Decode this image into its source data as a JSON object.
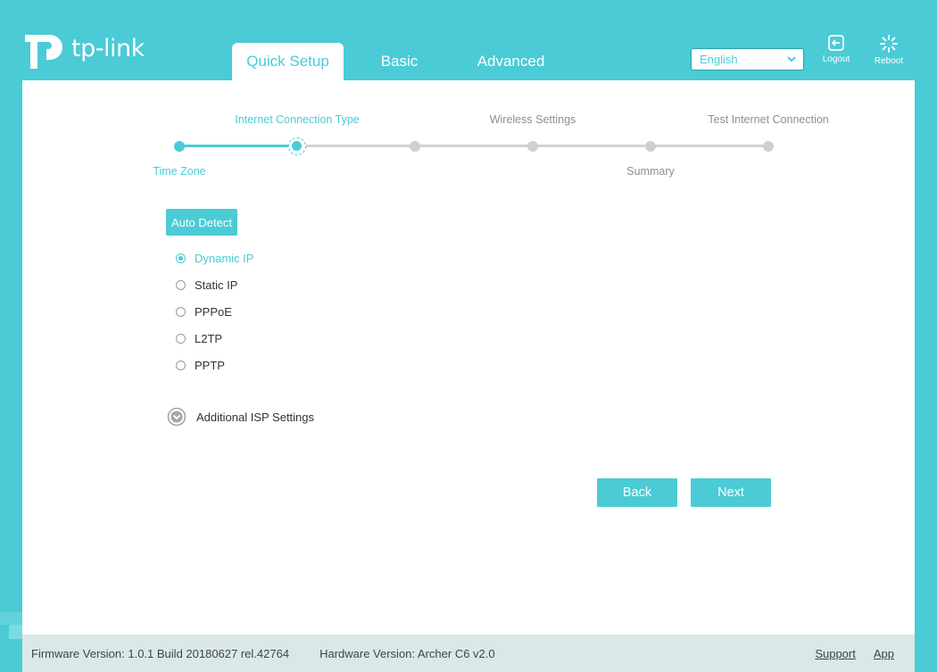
{
  "header": {
    "logo_text": "tp-link",
    "tabs": [
      {
        "label": "Quick Setup",
        "active": true
      },
      {
        "label": "Basic",
        "active": false
      },
      {
        "label": "Advanced",
        "active": false
      }
    ],
    "language": {
      "selected": "English"
    },
    "actions": [
      {
        "label": "Logout",
        "icon": "logout-icon"
      },
      {
        "label": "Reboot",
        "icon": "reboot-icon"
      }
    ]
  },
  "progress": {
    "steps": [
      {
        "label": "Time Zone",
        "state": "done"
      },
      {
        "label": "Internet Connection Type",
        "state": "current"
      },
      {
        "label": "Wireless Settings",
        "state": "todo"
      },
      {
        "label": "",
        "state": "todo"
      },
      {
        "label": "Summary",
        "state": "todo"
      },
      {
        "label": "Test Internet Connection",
        "state": "todo"
      }
    ]
  },
  "form": {
    "auto_detect_label": "Auto Detect",
    "connection_types": [
      {
        "label": "Dynamic IP",
        "checked": true
      },
      {
        "label": "Static IP",
        "checked": false
      },
      {
        "label": "PPPoE",
        "checked": false
      },
      {
        "label": "L2TP",
        "checked": false
      },
      {
        "label": "PPTP",
        "checked": false
      }
    ],
    "additional_isp_label": "Additional ISP Settings"
  },
  "buttons": {
    "back_label": "Back",
    "next_label": "Next"
  },
  "footer": {
    "firmware": "Firmware Version: 1.0.1 Build 20180627 rel.42764",
    "hardware": "Hardware Version: Archer C6 v2.0",
    "support_label": "Support",
    "app_label": "App"
  },
  "colors": {
    "accent": "#4acbd6",
    "footer_bg": "#dbe8e9",
    "inactive_track": "#d2d2d2"
  }
}
